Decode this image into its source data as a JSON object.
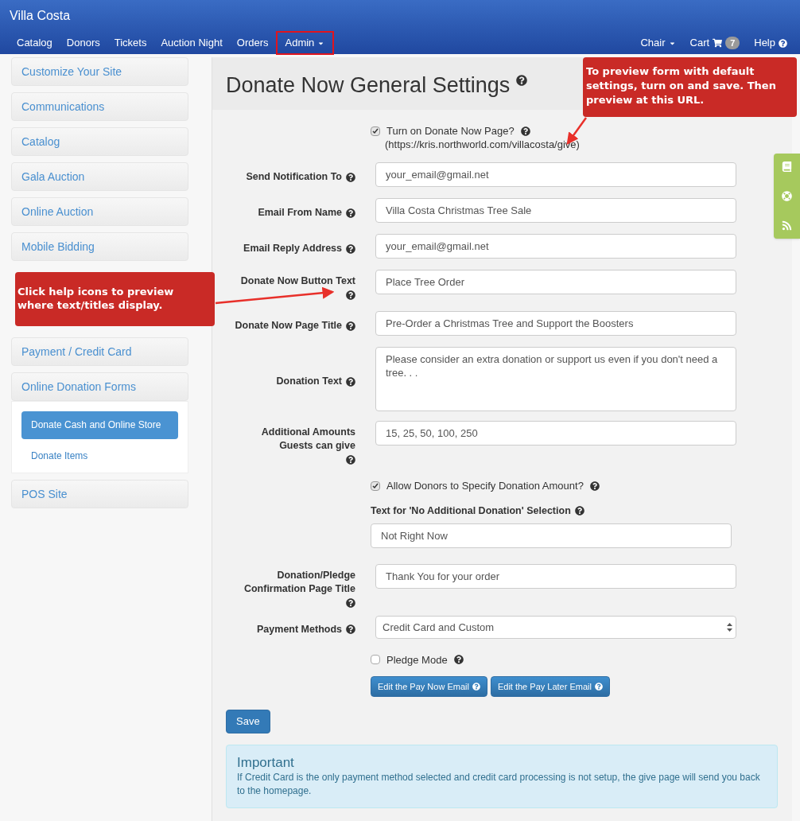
{
  "navbar": {
    "brand": "Villa Costa",
    "left": [
      {
        "label": "Catalog",
        "dropdown": false,
        "highlighted": false
      },
      {
        "label": "Donors",
        "dropdown": false,
        "highlighted": false
      },
      {
        "label": "Tickets",
        "dropdown": false,
        "highlighted": false
      },
      {
        "label": "Auction Night",
        "dropdown": false,
        "highlighted": false
      },
      {
        "label": "Orders",
        "dropdown": false,
        "highlighted": false
      },
      {
        "label": "Admin",
        "dropdown": true,
        "highlighted": true
      }
    ],
    "right": [
      {
        "kind": "dropdown",
        "label": "Chair"
      },
      {
        "kind": "cart",
        "label": "Cart",
        "badge": "7"
      },
      {
        "kind": "help",
        "label": "Help"
      }
    ]
  },
  "sidebar": {
    "items": [
      {
        "label": "Customize Your Site"
      },
      {
        "label": "Communications"
      },
      {
        "label": "Catalog"
      },
      {
        "label": "Gala Auction"
      },
      {
        "label": "Online Auction"
      },
      {
        "label": "Mobile Bidding"
      },
      {
        "kind": "callout",
        "text": "Click help icons to preview where text/titles display."
      },
      {
        "label": "Payment / Credit Card"
      },
      {
        "label": "Online Donation Forms",
        "children": [
          {
            "label": "Donate Cash and Online Store",
            "selected": true
          },
          {
            "label": "Donate Items",
            "selected": false
          }
        ]
      },
      {
        "label": "POS Site"
      }
    ]
  },
  "page": {
    "title": "Donate Now General Settings",
    "fields": [
      {
        "kind": "checkbox",
        "label": "Turn on Donate Now Page?",
        "checked": true,
        "help": true,
        "note": "(https://kris.northworld.com/villacosta/give)"
      },
      {
        "kind": "text",
        "label": "Send Notification To",
        "value": "your_email@gmail.net",
        "help": true
      },
      {
        "kind": "text",
        "label": "Email From Name",
        "value": "Villa Costa Christmas Tree Sale",
        "help": true
      },
      {
        "kind": "text",
        "label": "Email Reply Address",
        "value": "your_email@gmail.net",
        "help": true
      },
      {
        "kind": "text",
        "label": "Donate Now Button Text",
        "value": "Place Tree Order",
        "help": true
      },
      {
        "kind": "text",
        "label": "Donate Now Page Title",
        "value": "Pre-Order a Christmas Tree and Support the Boosters",
        "help": true
      },
      {
        "kind": "textarea",
        "label": "Donation Text",
        "value": "Please consider an extra donation or support us even if you don't need a tree. . .",
        "help": true
      },
      {
        "kind": "text",
        "label": "Additional Amounts Guests can give",
        "value": "15, 25, 50, 100, 250",
        "help": true
      },
      {
        "kind": "checkbox",
        "label": "Allow Donors to Specify Donation Amount?",
        "checked": true,
        "help": true
      },
      {
        "kind": "stacked",
        "label": "Text for 'No Additional Donation' Selection",
        "value": "Not Right Now",
        "help": true
      },
      {
        "kind": "text",
        "label": "Donation/Pledge Confirmation Page Title",
        "value": "Thank You for your order",
        "help": true
      },
      {
        "kind": "select",
        "label": "Payment Methods",
        "value": "Credit Card and Custom",
        "help": true
      },
      {
        "kind": "checkbox",
        "label": "Pledge Mode",
        "checked": false,
        "help": true
      },
      {
        "kind": "buttons",
        "buttons": [
          "Edit the Pay Now Email",
          "Edit the Pay Later Email"
        ]
      }
    ],
    "save": "Save",
    "alert": {
      "title": "Important",
      "text": "If Credit Card is the only payment method selected and credit card processing is not setup, the give page will send you back to the homepage."
    }
  },
  "callouts": [
    {
      "text": "To preview form with default settings, turn on and save.  Then preview at this URL."
    }
  ]
}
